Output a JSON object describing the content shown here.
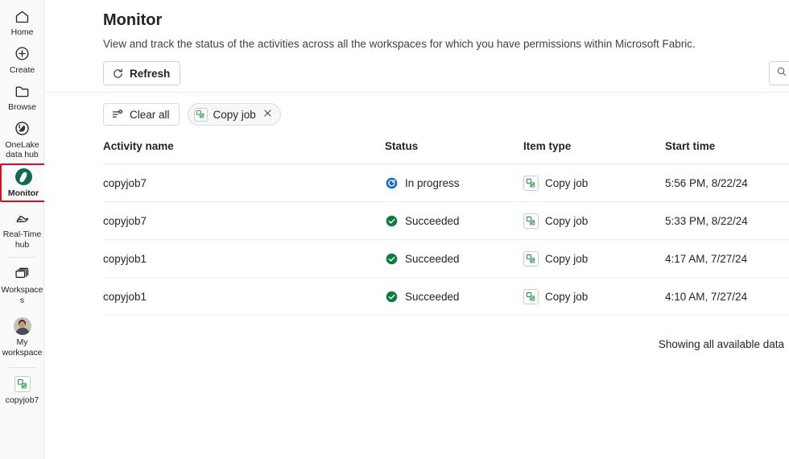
{
  "sidebar": {
    "items": [
      {
        "label": "Home",
        "icon": "home-icon",
        "selected": false
      },
      {
        "label": "Create",
        "icon": "plus-circle-icon",
        "selected": false
      },
      {
        "label": "Browse",
        "icon": "folder-icon",
        "selected": false
      },
      {
        "label": "OneLake data hub",
        "icon": "onelake-icon",
        "selected": false
      },
      {
        "label": "Monitor",
        "icon": "monitor-icon",
        "selected": true
      },
      {
        "label": "Real-Time hub",
        "icon": "realtime-hub-icon",
        "selected": false
      },
      {
        "label": "Workspaces",
        "icon": "workspaces-icon",
        "selected": false
      },
      {
        "label": "My workspace",
        "icon": "avatar-icon",
        "selected": false
      },
      {
        "label": "copyjob7",
        "icon": "copy-job-icon",
        "selected": false
      }
    ]
  },
  "header": {
    "title": "Monitor",
    "subtitle": "View and track the status of the activities across all the workspaces for which you have permissions within Microsoft Fabric."
  },
  "toolbar": {
    "refresh_label": "Refresh",
    "refresh_icon": "refresh-icon",
    "search_icon": "search-icon"
  },
  "filters": {
    "clear_all_label": "Clear all",
    "clear_all_icon": "clear-filter-icon",
    "chips": [
      {
        "label": "Copy job",
        "icon": "copy-job-icon",
        "close_icon": "close-icon"
      }
    ]
  },
  "table": {
    "columns": [
      "Activity name",
      "Status",
      "Item type",
      "Start time"
    ],
    "rows": [
      {
        "activity_name": "copyjob7",
        "status": "In progress",
        "status_kind": "in-progress",
        "item_type": "Copy job",
        "start_time": "5:56 PM, 8/22/24"
      },
      {
        "activity_name": "copyjob7",
        "status": "Succeeded",
        "status_kind": "succeeded",
        "item_type": "Copy job",
        "start_time": "5:33 PM, 8/22/24"
      },
      {
        "activity_name": "copyjob1",
        "status": "Succeeded",
        "status_kind": "succeeded",
        "item_type": "Copy job",
        "start_time": "4:17 AM, 7/27/24"
      },
      {
        "activity_name": "copyjob1",
        "status": "Succeeded",
        "status_kind": "succeeded",
        "item_type": "Copy job",
        "start_time": "4:10 AM, 7/27/24"
      }
    ],
    "footer_note": "Showing all available data"
  },
  "colors": {
    "highlight_box": "#e00b21",
    "status_succeeded": "#107c41",
    "status_in_progress": "#1668c1",
    "accent_green": "#0e6b52",
    "sidebar_bg": "#fafafa",
    "text_primary": "#242424"
  }
}
